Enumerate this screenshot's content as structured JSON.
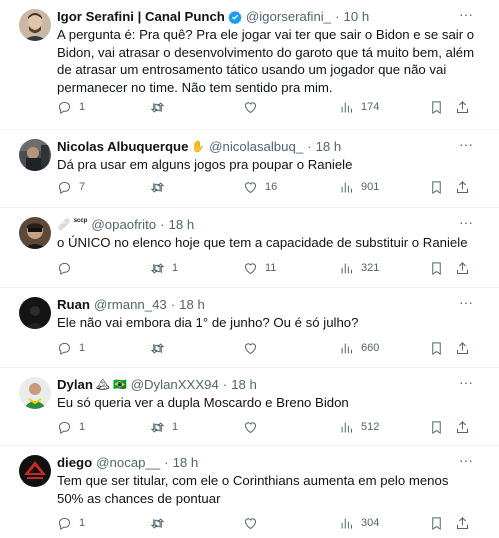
{
  "tweets": [
    {
      "name": "Igor Serafini | Canal Punch",
      "handle": "@igorserafini_",
      "dot": "·",
      "time": "10 h",
      "verified": true,
      "text": "A pergunta é: Pra quê? Pra ele jogar vai ter que sair o Bidon e se sair o Bidon, vai atrasar o desenvolvimento do garoto que tá muito bem, além de atrasar um entrosamento tático usando um jogador que não vai permanecer no time. Não tem sentido pra mim.",
      "replies": "1",
      "retweets": "",
      "likes": "",
      "views": "174"
    },
    {
      "name": "Nicolas Albuquerque",
      "handle": "@nicolasalbuq_",
      "dot": "·",
      "time": "18 h",
      "emoji": "✋",
      "text": "Dá pra usar em alguns jogos pra poupar o Raniele",
      "replies": "7",
      "retweets": "",
      "likes": "16",
      "views": "901"
    },
    {
      "name": "",
      "handle": "@opaofrito",
      "dot": "·",
      "time": "18 h",
      "prefix_emoji": "🩹",
      "prefix_tag": "sccp",
      "text": "o ÚNICO no elenco hoje que tem a capacidade de substituir o Raniele",
      "replies": "",
      "retweets": "1",
      "likes": "11",
      "views": "321"
    },
    {
      "name": "Ruan",
      "handle": "@rmann_43",
      "dot": "·",
      "time": "18 h",
      "text": "Ele não vai embora dia 1° de junho? Ou é só julho?",
      "replies": "1",
      "retweets": "",
      "likes": "",
      "views": "660"
    },
    {
      "name": "Dylan",
      "handle": "@DylanXXX94",
      "dot": "·",
      "time": "18 h",
      "emoji": "🏔 🇧🇷",
      "text": "Eu só queria ver a dupla Moscardo e Breno Bidon",
      "replies": "1",
      "retweets": "1",
      "likes": "",
      "views": "512"
    },
    {
      "name": "diego",
      "handle": "@nocap__",
      "dot": "·",
      "time": "18 h",
      "text": "Tem que ser titular, com ele o Corinthians aumenta em pelo menos 50% as chances de pontuar",
      "replies": "1",
      "retweets": "",
      "likes": "",
      "views": "304"
    }
  ],
  "more_glyph": "···",
  "colors": {
    "text": "#0f1419",
    "muted": "#536471",
    "verified": "#1d9bf0",
    "divider": "#eff3f4"
  },
  "icons": [
    "reply-icon",
    "retweet-icon",
    "like-icon",
    "views-icon",
    "bookmark-icon",
    "share-icon",
    "more-icon",
    "verified-icon"
  ]
}
